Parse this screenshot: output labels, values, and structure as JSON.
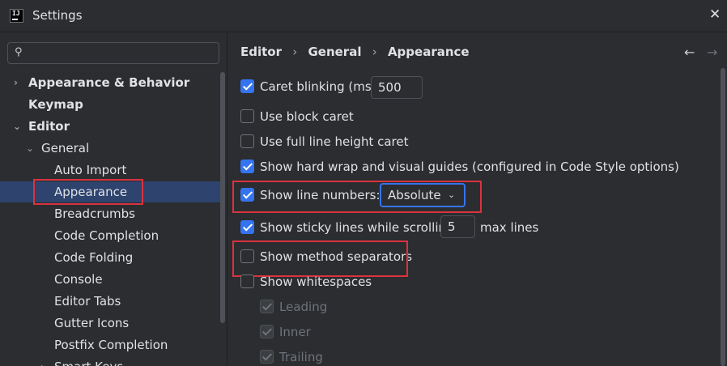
{
  "window": {
    "title": "Settings",
    "app_icon_text": "IJ",
    "close_glyph": "✕"
  },
  "search": {
    "icon": "⚲",
    "value": "",
    "placeholder": ""
  },
  "sidebar": {
    "items": [
      {
        "label": "Appearance & Behavior",
        "chevron": "›"
      },
      {
        "label": "Keymap"
      },
      {
        "label": "Editor",
        "chevron": "⌄"
      },
      {
        "label": "General",
        "chevron": "⌄"
      },
      {
        "label": "Auto Import"
      },
      {
        "label": "Appearance"
      },
      {
        "label": "Breadcrumbs"
      },
      {
        "label": "Code Completion"
      },
      {
        "label": "Code Folding"
      },
      {
        "label": "Console"
      },
      {
        "label": "Editor Tabs"
      },
      {
        "label": "Gutter Icons"
      },
      {
        "label": "Postfix Completion"
      },
      {
        "label": "Smart Keys",
        "chevron": "›"
      }
    ]
  },
  "breadcrumb": {
    "items": [
      "Editor",
      "General",
      "Appearance"
    ],
    "separator": "›",
    "back": "←",
    "forward": "→"
  },
  "options": {
    "caret_blinking": {
      "label": "Caret blinking (ms):",
      "value": "500",
      "checked": true
    },
    "block_caret": {
      "label": "Use block caret",
      "checked": false
    },
    "full_line_height": {
      "label": "Use full line height caret",
      "checked": false
    },
    "hard_wrap": {
      "label": "Show hard wrap and visual guides (configured in Code Style options)",
      "checked": true
    },
    "line_numbers": {
      "label": "Show line numbers:",
      "value": "Absolute",
      "arrow": "⌄",
      "checked": true
    },
    "sticky_lines": {
      "label": "Show sticky lines while scrolling:",
      "value": "5",
      "suffix": "max lines",
      "checked": true
    },
    "method_separators": {
      "label": "Show method separators",
      "checked": false
    },
    "whitespaces": {
      "label": "Show whitespaces",
      "checked": false
    },
    "leading": {
      "label": "Leading",
      "checked": true
    },
    "inner": {
      "label": "Inner",
      "checked": true
    },
    "trailing": {
      "label": "Trailing",
      "checked": true
    }
  },
  "colors": {
    "accent": "#3574f0",
    "selection": "#2e436e",
    "highlight": "#d9333f",
    "background": "#2b2d30"
  }
}
